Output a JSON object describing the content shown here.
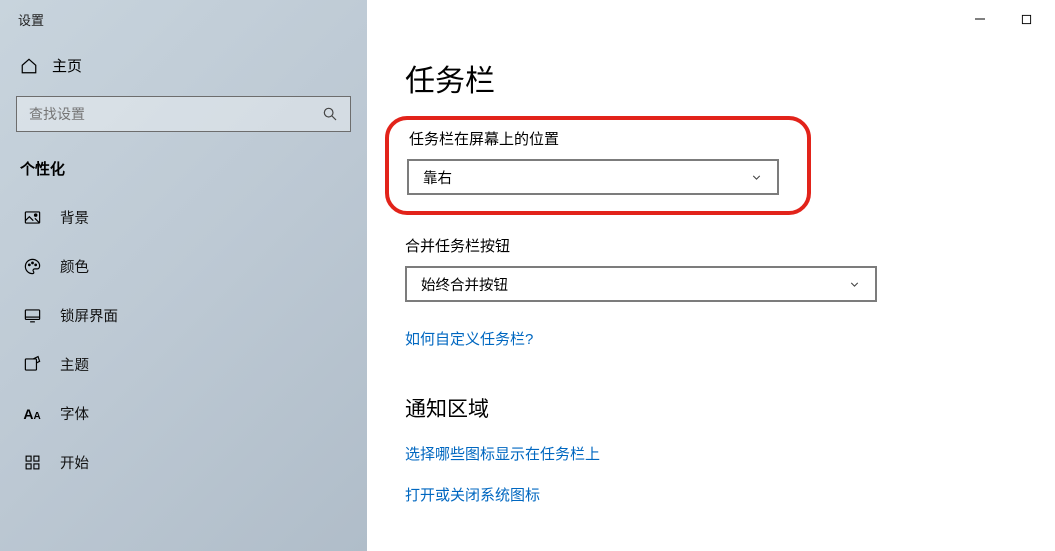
{
  "app_title": "设置",
  "home_label": "主页",
  "search": {
    "placeholder": "查找设置"
  },
  "section": "个性化",
  "nav": {
    "background": "背景",
    "colors": "颜色",
    "lockscreen": "锁屏界面",
    "themes": "主题",
    "fonts": "字体",
    "start": "开始"
  },
  "main": {
    "title": "任务栏",
    "position": {
      "label": "任务栏在屏幕上的位置",
      "value": "靠右"
    },
    "combine": {
      "label": "合并任务栏按钮",
      "value": "始终合并按钮"
    },
    "link_customize": "如何自定义任务栏?",
    "notif_heading": "通知区域",
    "link_icons": "选择哪些图标显示在任务栏上",
    "link_sysicons": "打开或关闭系统图标"
  }
}
